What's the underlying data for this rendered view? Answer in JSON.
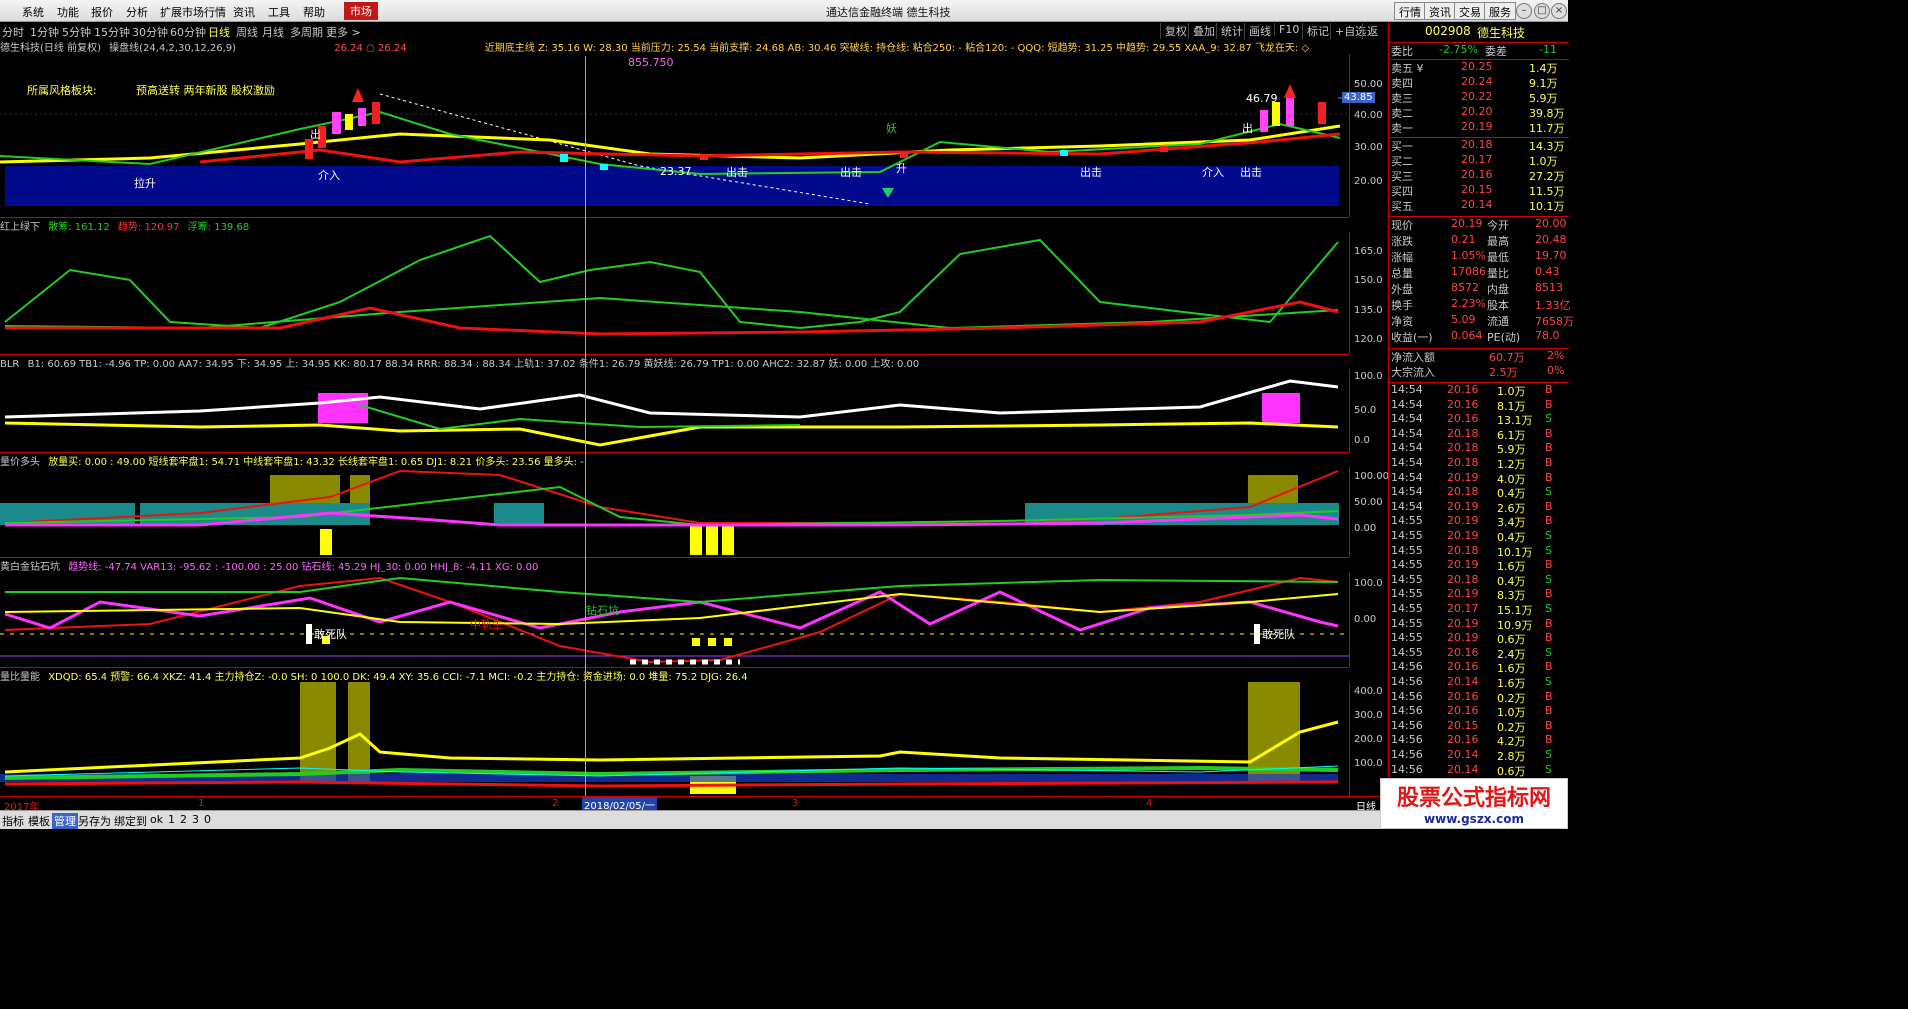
{
  "menu": [
    "系统",
    "功能",
    "报价",
    "分析",
    "扩展市场行情",
    "资讯",
    "工具",
    "帮助"
  ],
  "market_tab": "市场",
  "app_title": "通达信金融终端  德生科技",
  "top_right": [
    "行情",
    "资讯",
    "交易",
    "服务"
  ],
  "periods": [
    "分时",
    "1分钟",
    "5分钟",
    "15分钟",
    "30分钟",
    "60分钟",
    "日线",
    "周线",
    "月线",
    "多周期",
    "更多 >"
  ],
  "active_period": "日线",
  "toolbar_right": [
    "复权",
    "叠加",
    "统计",
    "画线",
    "F10",
    "标记",
    "+自选",
    "返回"
  ],
  "pane1": {
    "title": "德生科技(日线 前复权)",
    "indicator": "操盘线(24,4,2,30,12,26,9)",
    "vals": "26.24 ○ 26.24",
    "right": "近期底主线   Z: 35.16  W: 28.30   当前压力: 25.54  当前支撑: 24.68  AB: 30.46  突破线:   持仓线:   粘合250: -  粘合120: -  QQQ:   短趋势: 31.25  中趋势: 29.55   XAA_9: 32.87  飞龙在天: ◇",
    "note_a": "所属风格板块:",
    "note_b": "预高送转 两年新股 股权激励",
    "high_label": "855.750",
    "price_tag": "43.85",
    "peak_label": "46.79",
    "low_label": "23.37",
    "labels": {
      "lashen": "拉升",
      "jieru1": "介入",
      "chuji1": "出击",
      "chuji2": "出击",
      "chuji3": "出击",
      "jieru2": "介入",
      "chuji4": "出击",
      "sheng": "升",
      "yao": "妖",
      "chu1": "出",
      "chu2": "出"
    },
    "yticks": [
      "50.00",
      "40.00",
      "30.00",
      "20.00"
    ]
  },
  "pane2": {
    "name": "红上绿下",
    "f1": "散筹: 161.12",
    "f2": "趋势: 120.97",
    "f3": "浮筹: 139.68",
    "yticks": [
      "165.0",
      "150.0",
      "135.0",
      "120.0"
    ]
  },
  "pane3": {
    "name": "BLR",
    "text": "B1: 60.69  TB1: -4.96  TP: 0.00  AA7: 34.95    下: 34.95  上: 34.95    KK: 80.17    88.34  RRR: 88.34 : 88.34    上轨1: 37.02  条件1: 26.79  黄妖线: 26.79  TP1: 0.00    AHC2: 32.87  妖: 0.00    上攻: 0.00",
    "yticks": [
      "100.0",
      "50.0",
      "0.0"
    ]
  },
  "pane4": {
    "name": "量价多头",
    "text": "放量买: 0.00 : 49.00    短线套牢盘1: 54.71  中线套牢盘1: 43.32  长线套牢盘1: 0.65   DJ1: 8.21  价多头: 23.56  量多头: -",
    "yticks": [
      "100.00",
      "50.00",
      "0.00"
    ]
  },
  "pane5": {
    "name": "黄白金钻石坑",
    "text": "趋势线: -47.74  VAR13: -95.62  : -100.00  : 25.00  钻石线: 45.29     HJ_30: 0.00      HHJ_8: -4.11   XG: 0.00",
    "label_a": "敢死队",
    "label_b": "敢死队",
    "label_c": "钻石坑",
    "label_d": "中轨生",
    "yticks": [
      "100.0",
      "0.00"
    ]
  },
  "pane6": {
    "name": "量比量能",
    "text": "XDQD: 65.4  预警: 66.4  XKZ: 41.4  主力持仓Z: -0.0   SH: 0  100.0  DK: 49.4  XY: 35.6  CCI: -7.1  MCI: -0.2   主力持仓:  资金进场: 0.0       堆量: 75.2   DJG: 26.4",
    "yticks": [
      "400.0",
      "300.0",
      "200.0",
      "100.0"
    ]
  },
  "dates": {
    "d0": "2017年",
    "d1": "1",
    "d2": "2",
    "cursor": "2018/02/05/一",
    "d3": "3",
    "d4": "4",
    "unit": "日线"
  },
  "quote": {
    "code": "002908",
    "name": "德生科技",
    "weibi_l": "委比",
    "weibi_v": "-2.75%",
    "weicha_l": "委差",
    "weicha_v": "-11",
    "asks": [
      [
        "卖五 ¥",
        "20.25",
        "1.4万"
      ],
      [
        "卖四",
        "20.24",
        "9.1万"
      ],
      [
        "卖三",
        "20.22",
        "5.9万"
      ],
      [
        "卖二",
        "20.20",
        "39.8万"
      ],
      [
        "卖一",
        "20.19",
        "11.7万"
      ]
    ],
    "bids": [
      [
        "买一",
        "20.18",
        "14.3万"
      ],
      [
        "买二",
        "20.17",
        "1.0万"
      ],
      [
        "买三",
        "20.16",
        "27.2万"
      ],
      [
        "买四",
        "20.15",
        "11.5万"
      ],
      [
        "买五",
        "20.14",
        "10.1万"
      ]
    ],
    "stats": [
      [
        "现价",
        "20.19",
        "今开",
        "20.00"
      ],
      [
        "涨跌",
        "0.21",
        "最高",
        "20.48"
      ],
      [
        "涨幅",
        "1.05%",
        "最低",
        "19.70"
      ],
      [
        "总量",
        "17086",
        "量比",
        "0.43"
      ],
      [
        "外盘",
        "8572",
        "内盘",
        "8513"
      ],
      [
        "换手",
        "2.23%",
        "股本",
        "1.33亿"
      ],
      [
        "净资",
        "5.09",
        "流通",
        "7658万"
      ],
      [
        "收益(一)",
        "0.064",
        "PE(动)",
        "78.0"
      ]
    ],
    "flow": [
      [
        "净流入额",
        "60.7万",
        "2%"
      ],
      [
        "大宗流入",
        "2.5万",
        "0%"
      ]
    ]
  },
  "ticks": [
    [
      "14:54",
      "20.16",
      "1.0万",
      "B"
    ],
    [
      "14:54",
      "20.16",
      "8.1万",
      "B"
    ],
    [
      "14:54",
      "20.16",
      "13.1万",
      "S"
    ],
    [
      "14:54",
      "20.18",
      "6.1万",
      "B"
    ],
    [
      "14:54",
      "20.18",
      "5.9万",
      "B"
    ],
    [
      "14:54",
      "20.18",
      "1.2万",
      "B"
    ],
    [
      "14:54",
      "20.19",
      "4.0万",
      "B"
    ],
    [
      "14:54",
      "20.18",
      "0.4万",
      "S"
    ],
    [
      "14:54",
      "20.19",
      "2.6万",
      "B"
    ],
    [
      "14:55",
      "20.19",
      "3.4万",
      "B"
    ],
    [
      "14:55",
      "20.19",
      "0.4万",
      "S"
    ],
    [
      "14:55",
      "20.18",
      "10.1万",
      "S"
    ],
    [
      "14:55",
      "20.19",
      "1.6万",
      "B"
    ],
    [
      "14:55",
      "20.18",
      "0.4万",
      "S"
    ],
    [
      "14:55",
      "20.19",
      "8.3万",
      "B"
    ],
    [
      "14:55",
      "20.17",
      "15.1万",
      "S"
    ],
    [
      "14:55",
      "20.19",
      "10.9万",
      "B"
    ],
    [
      "14:55",
      "20.19",
      "0.6万",
      "B"
    ],
    [
      "14:55",
      "20.16",
      "2.4万",
      "S"
    ],
    [
      "14:56",
      "20.16",
      "1.6万",
      "B"
    ],
    [
      "14:56",
      "20.14",
      "1.6万",
      "S"
    ],
    [
      "14:56",
      "20.16",
      "0.2万",
      "B"
    ],
    [
      "14:56",
      "20.16",
      "1.0万",
      "B"
    ],
    [
      "14:56",
      "20.15",
      "0.2万",
      "B"
    ],
    [
      "14:56",
      "20.16",
      "4.2万",
      "B"
    ],
    [
      "14:56",
      "20.14",
      "2.8万",
      "S"
    ],
    [
      "14:56",
      "20.14",
      "0.6万",
      "S"
    ]
  ],
  "bottom": [
    "指标",
    "模板",
    "管理",
    "另存为",
    "绑定到",
    "ok",
    "1",
    "2",
    "3",
    "0"
  ],
  "watermark": {
    "line1": "股票公式指标网",
    "line2": "www.gszx.com"
  }
}
